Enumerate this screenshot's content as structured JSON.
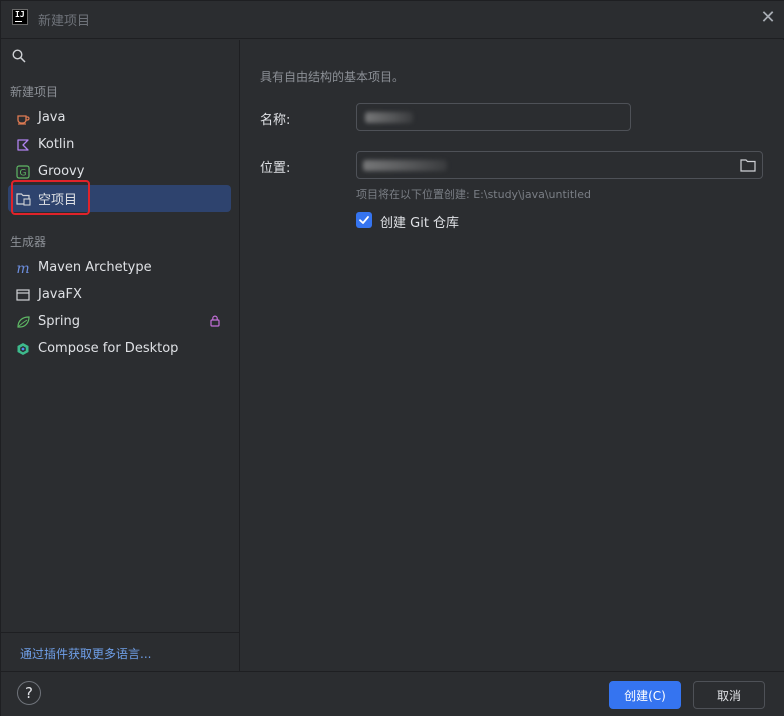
{
  "window": {
    "logo_text": "IJ",
    "title": "新建项目",
    "close_glyph": "✕"
  },
  "sidebar": {
    "new_project_header": "新建项目",
    "new_project_items": [
      {
        "label": "Java",
        "icon": "java-cup-icon"
      },
      {
        "label": "Kotlin",
        "icon": "kotlin-icon"
      },
      {
        "label": "Groovy",
        "icon": "groovy-icon"
      },
      {
        "label": "空项目",
        "icon": "empty-project-icon",
        "selected": true
      }
    ],
    "generators_header": "生成器",
    "generator_items": [
      {
        "label": "Maven Archetype",
        "icon": "maven-icon"
      },
      {
        "label": "JavaFX",
        "icon": "javafx-window-icon"
      },
      {
        "label": "Spring",
        "icon": "spring-leaf-icon",
        "locked": true
      },
      {
        "label": "Compose for Desktop",
        "icon": "compose-icon"
      }
    ],
    "plugins_link": "通过插件获取更多语言..."
  },
  "main": {
    "description": "具有自由结构的基本项目。",
    "name_label": "名称:",
    "location_label": "位置:",
    "location_hint": "项目将在以下位置创建: E:\\study\\java\\untitled",
    "git_checkbox_label": "创建 Git 仓库",
    "git_checked": true
  },
  "footer": {
    "help_glyph": "?",
    "create_button": "创建(C)",
    "cancel_button": "取消"
  },
  "colors": {
    "accent": "#3574f0",
    "selected_bg": "#2e436e",
    "highlight_box": "#e0232a",
    "link": "#6f9fe8"
  }
}
